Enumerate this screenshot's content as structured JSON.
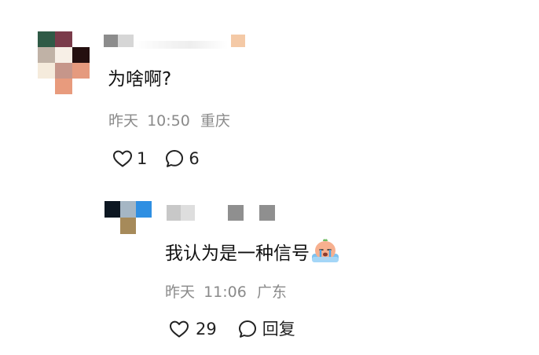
{
  "comments": [
    {
      "text": "为啥啊?",
      "date": "昨天",
      "time": "10:50",
      "location": "重庆",
      "likes": "1",
      "reply_count": "6"
    }
  ],
  "reply": {
    "text": "我认为是一种信号",
    "emoji": "crying-peach-emoji",
    "date": "昨天",
    "time": "11:06",
    "location": "广东",
    "likes": "29",
    "reply_label": "回复"
  },
  "colors": {
    "text_primary": "#111111",
    "text_meta": "#8a8a8a",
    "icon_stroke": "#222222",
    "avatar_main_pixels": [
      "#2f5a46",
      "#7a3b4a",
      "#ffffff",
      "#c0b2a6",
      "#f7efe6",
      "#241010",
      "#f5ebdc",
      "#c6968a",
      "#e59a7e",
      "#ffffff",
      "#e89b7d",
      "#ffffff"
    ],
    "avatar_reply_pixels": [
      "#0d1722",
      "#a5b6c4",
      "#2f8fe2",
      "#ffffff",
      "#a68a5a",
      "#ffffff"
    ]
  }
}
